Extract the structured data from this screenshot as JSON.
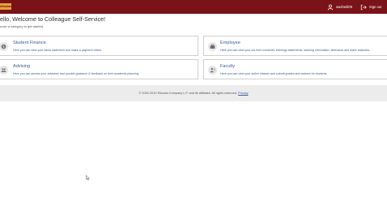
{
  "header": {
    "logo_text": "ellucian",
    "username": "washeld09",
    "signout_label": "Sign out",
    "bar_color": "#7a1318",
    "logo_color": "#e8a23b",
    "user_icon": "user-icon",
    "signout_icon": "sign-out-icon"
  },
  "welcome": {
    "title": "ello, Welcome to Colleague Self-Service!",
    "subtitle": "oose a category to get started."
  },
  "cards": [
    {
      "title": "Student Finance",
      "description": "Here you can view your latest statement and make a payment online.",
      "icon": "dollar-icon"
    },
    {
      "title": "Employee",
      "description": "Here you can view your tax form consents, earnings statements, banking information, timecards and leave balances.",
      "icon": "briefcase-icon"
    },
    {
      "title": "Advising",
      "description": "Here you can access your advisees and provide guidance & feedback on their academic planning.",
      "icon": "people-icon"
    },
    {
      "title": "Faculty",
      "description": "Here you can view your active classes and submit grades and waivers for students.",
      "icon": "faculty-icon"
    }
  ],
  "footer": {
    "copyright": "© 2000-2019 Ellucian Company L.P. and its affiliates. All rights reserved.",
    "privacy_label": "Privacy"
  },
  "link_color": "#3a5b97"
}
